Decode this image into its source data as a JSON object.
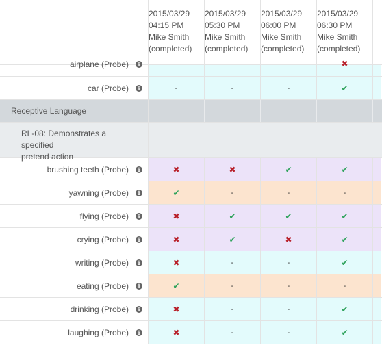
{
  "columns": [
    {
      "date": "2015/03/29",
      "time": "04:15 PM",
      "user": "Mike Smith",
      "status": "(completed)"
    },
    {
      "date": "2015/03/29",
      "time": "05:30 PM",
      "user": "Mike Smith",
      "status": "(completed)"
    },
    {
      "date": "2015/03/29",
      "time": "06:00 PM",
      "user": "Mike Smith",
      "status": "(completed)"
    },
    {
      "date": "2015/03/29",
      "time": "06:30 PM",
      "user": "Mike Smith",
      "status": "(completed)"
    }
  ],
  "rows_top": [
    {
      "label": "airplane (Probe)",
      "color": "cyan",
      "values": [
        "",
        "",
        "",
        "cross"
      ]
    },
    {
      "label": "car (Probe)",
      "color": "cyan",
      "values": [
        "dash",
        "dash",
        "dash",
        "check"
      ]
    }
  ],
  "section": {
    "title": "Receptive Language"
  },
  "subsection": {
    "title_line1": "RL-08: Demonstrates a specified",
    "title_line2": "pretend action"
  },
  "rows": [
    {
      "label": "brushing teeth (Probe)",
      "color": "lav",
      "values": [
        "cross",
        "cross",
        "check",
        "check"
      ]
    },
    {
      "label": "yawning (Probe)",
      "color": "peach",
      "values": [
        "check",
        "dash",
        "dash",
        "dash"
      ]
    },
    {
      "label": "flying (Probe)",
      "color": "lav",
      "values": [
        "cross",
        "check",
        "check",
        "check"
      ]
    },
    {
      "label": "crying (Probe)",
      "color": "lav",
      "values": [
        "cross",
        "check",
        "cross",
        "check"
      ]
    },
    {
      "label": "writing (Probe)",
      "color": "cyan",
      "values": [
        "cross",
        "dash",
        "dash",
        "check"
      ]
    },
    {
      "label": "eating (Probe)",
      "color": "peach",
      "values": [
        "check",
        "dash",
        "dash",
        "dash"
      ]
    },
    {
      "label": "drinking (Probe)",
      "color": "cyan",
      "values": [
        "cross",
        "dash",
        "dash",
        "check"
      ]
    },
    {
      "label": "laughing (Probe)",
      "color": "cyan",
      "values": [
        "cross",
        "dash",
        "dash",
        "check"
      ]
    }
  ],
  "symbols": {
    "check": "✔",
    "cross": "✖",
    "dash": "-",
    "info": "i"
  },
  "colors": {
    "cyan": "#e3fbfc",
    "lavender": "#ece3f9",
    "peach": "#fce4cf",
    "section": "#d3d8dc",
    "subsection": "#e9ecee",
    "check": "#2ea25b",
    "cross": "#b8202a"
  }
}
